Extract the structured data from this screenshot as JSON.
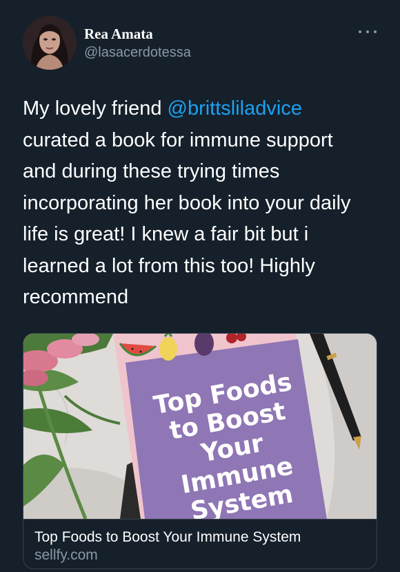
{
  "tweet": {
    "author": {
      "display_name": "Rea Amata",
      "handle": "@lasacerdotessa"
    },
    "text": {
      "line1_prefix": "My lovely friend ",
      "mention": "@brittsliladvice",
      "line2": "curated a book for immune support",
      "line3": "and during these trying times",
      "line4": "incorporating her book into your daily",
      "line5": "life is great! I knew a fair bit but i",
      "line6": "learned a lot from this too! Highly",
      "line7": "recommend"
    },
    "more_icon": "more-horizontal-icon"
  },
  "card": {
    "image": {
      "book_cover_lines": [
        "Top Foods",
        "to Boost",
        "Your",
        "Immune",
        "System"
      ]
    },
    "title": "Top Foods to Boost Your Immune System",
    "domain": "sellfy.com"
  },
  "colors": {
    "background": "#15202b",
    "text_primary": "#ffffff",
    "text_secondary": "#8899a6",
    "link": "#1da1f2",
    "border": "#38444d",
    "book_purple": "#8f76b4",
    "book_pink": "#f0c4cc"
  }
}
